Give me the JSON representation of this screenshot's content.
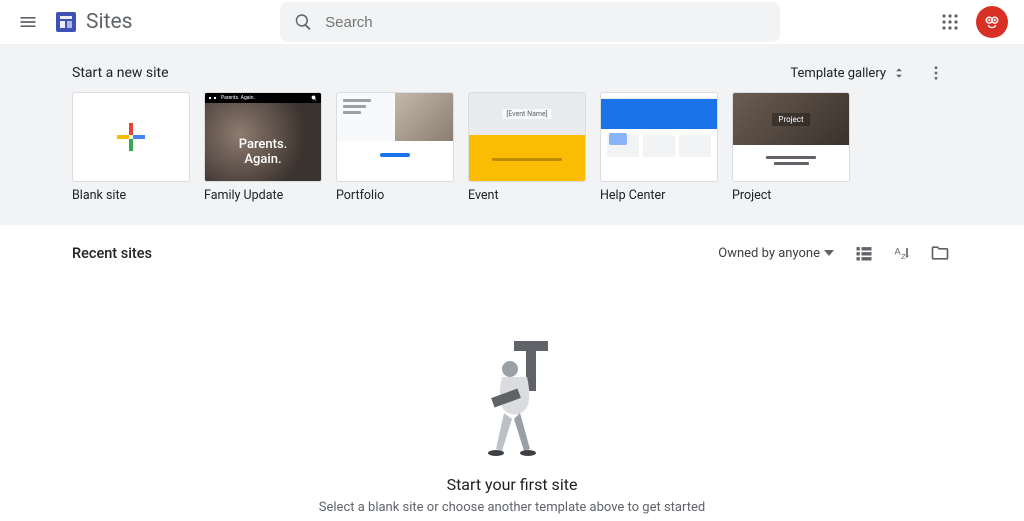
{
  "header": {
    "app_name": "Sites",
    "search_placeholder": "Search"
  },
  "gallery": {
    "title": "Start a new site",
    "template_gallery_label": "Template gallery",
    "templates": [
      {
        "label": "Blank site"
      },
      {
        "label": "Family Update",
        "overlay_line1": "Parents.",
        "overlay_line2": "Again."
      },
      {
        "label": "Portfolio"
      },
      {
        "label": "Event",
        "overlay": "[Event Name]"
      },
      {
        "label": "Help Center"
      },
      {
        "label": "Project"
      }
    ]
  },
  "recent": {
    "title": "Recent sites",
    "owned_label": "Owned by anyone"
  },
  "empty": {
    "title": "Start your first site",
    "subtitle": "Select a blank site or choose another template above to get started"
  }
}
